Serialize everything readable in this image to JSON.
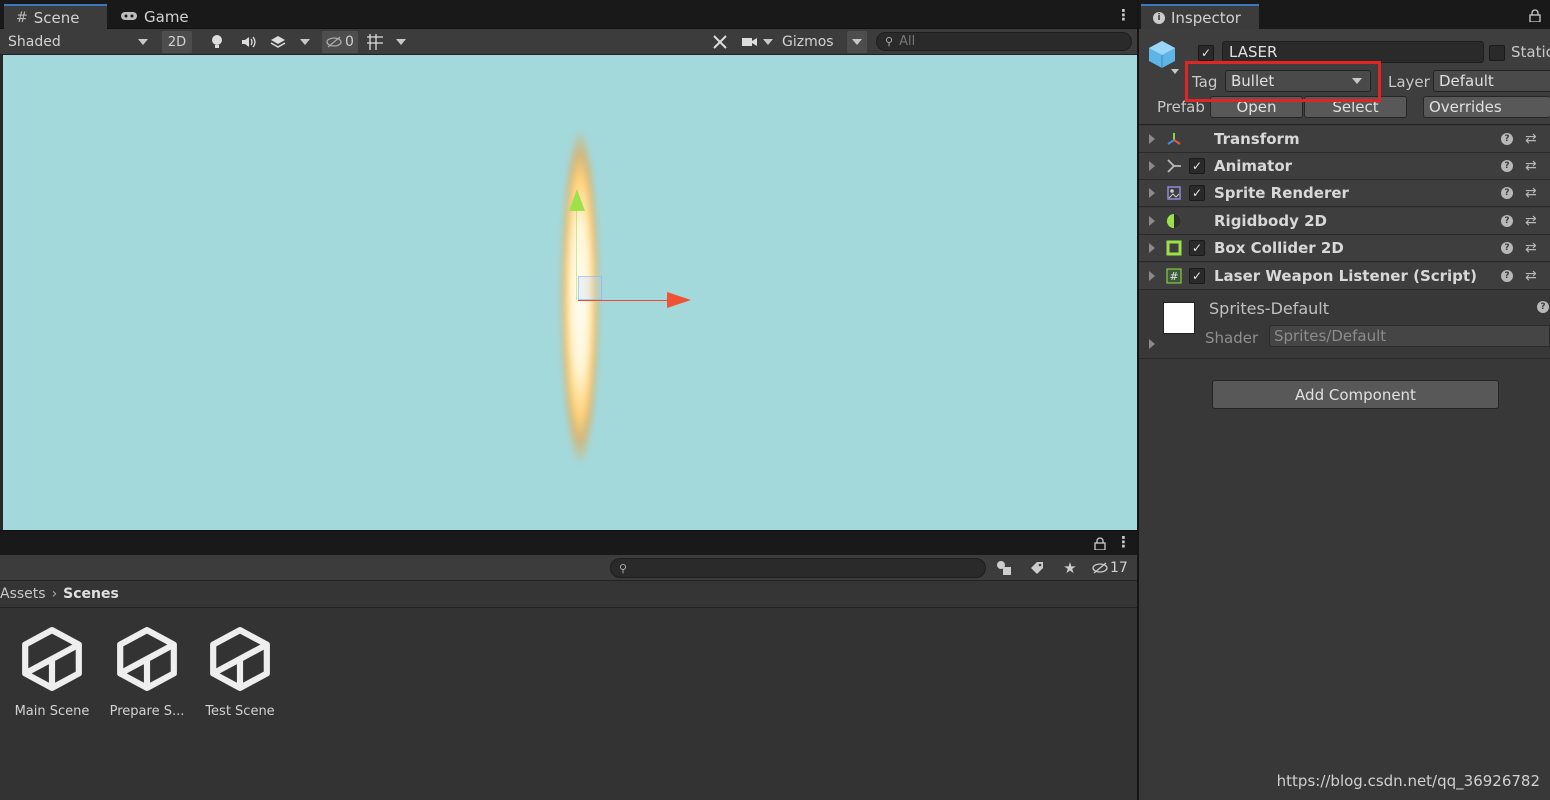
{
  "tabs": {
    "scene": "Scene",
    "game": "Game",
    "inspector": "Inspector"
  },
  "scene_toolbar": {
    "shading_mode": "Shaded",
    "mode_2d": "2D",
    "hidden_count": "0",
    "gizmos": "Gizmos",
    "search_placeholder": "All"
  },
  "project": {
    "hidden_count": "17",
    "breadcrumb": {
      "root": "Assets",
      "current": "Scenes"
    },
    "assets": [
      {
        "label": "Main Scene"
      },
      {
        "label": "Prepare S..."
      },
      {
        "label": "Test Scene"
      }
    ]
  },
  "inspector": {
    "object_name": "LASER",
    "static_label": "Static",
    "tag_label": "Tag",
    "tag_value": "Bullet",
    "layer_label": "Layer",
    "layer_value": "Default",
    "prefab_label": "Prefab",
    "prefab_open": "Open",
    "prefab_select": "Select",
    "prefab_overrides": "Overrides",
    "components": [
      {
        "name": "Transform",
        "icon": "transform-icon",
        "has_checkbox": false
      },
      {
        "name": "Animator",
        "icon": "animator-icon",
        "has_checkbox": true
      },
      {
        "name": "Sprite Renderer",
        "icon": "sprite-renderer-icon",
        "has_checkbox": true
      },
      {
        "name": "Rigidbody 2D",
        "icon": "rigidbody-icon",
        "has_checkbox": false
      },
      {
        "name": "Box Collider 2D",
        "icon": "box-collider-icon",
        "has_checkbox": true
      },
      {
        "name": "Laser Weapon Listener (Script)",
        "icon": "script-icon",
        "has_checkbox": true
      }
    ],
    "material": {
      "name": "Sprites-Default",
      "shader_label": "Shader",
      "shader_value": "Sprites/Default"
    },
    "add_component": "Add Component"
  },
  "watermark": "https://blog.csdn.net/qq_36926782",
  "colors": {
    "scene_background": "#a4d9dc",
    "highlight": "#e12525",
    "accent": "#3a79bb"
  }
}
